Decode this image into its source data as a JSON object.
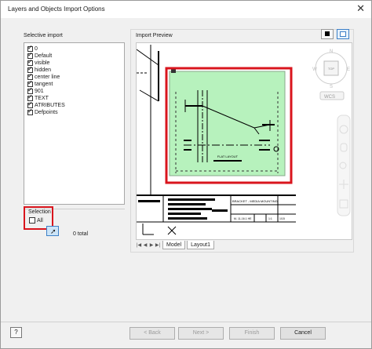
{
  "dialog": {
    "title": "Layers and Objects Import Options",
    "close_glyph": "✕"
  },
  "selective_import": {
    "label": "Selective import",
    "layers": [
      {
        "name": "0",
        "checked": true
      },
      {
        "name": "Default",
        "checked": true
      },
      {
        "name": "visible",
        "checked": true
      },
      {
        "name": "hidden",
        "checked": true
      },
      {
        "name": "center line",
        "checked": true
      },
      {
        "name": "tangent",
        "checked": true
      },
      {
        "name": "901",
        "checked": true
      },
      {
        "name": "TEXT",
        "checked": true
      },
      {
        "name": "ATRIBUTES",
        "checked": true
      },
      {
        "name": "Defpoints",
        "checked": true
      }
    ]
  },
  "selection": {
    "label": "Selection",
    "all_label": "All",
    "all_checked": false,
    "total": "0 total"
  },
  "preview": {
    "label": "Import Preview",
    "viewcube": {
      "top": "TOP",
      "north": "N",
      "south": "S",
      "east": "E",
      "west": "W",
      "wcs": "WCS"
    },
    "drawing": {
      "center_label": "FLAT LAYOUT",
      "title_block_text": "BRACKET - MEDIA MOUNTING",
      "title_block_code": "M- 11-16.1 HE",
      "title_block_scale": "1:1",
      "title_block_sheet": "1/15"
    },
    "tabs": [
      "Model",
      "Layout1"
    ],
    "active_tab": "Model"
  },
  "footer": {
    "help_label": "?",
    "back_label": "< Back",
    "next_label": "Next >",
    "finish_label": "Finish",
    "cancel_label": "Cancel"
  },
  "colors": {
    "highlight_red": "#d9151d",
    "drawing_green": "#b7f2bd",
    "selected_blue": "#3d80c8"
  }
}
